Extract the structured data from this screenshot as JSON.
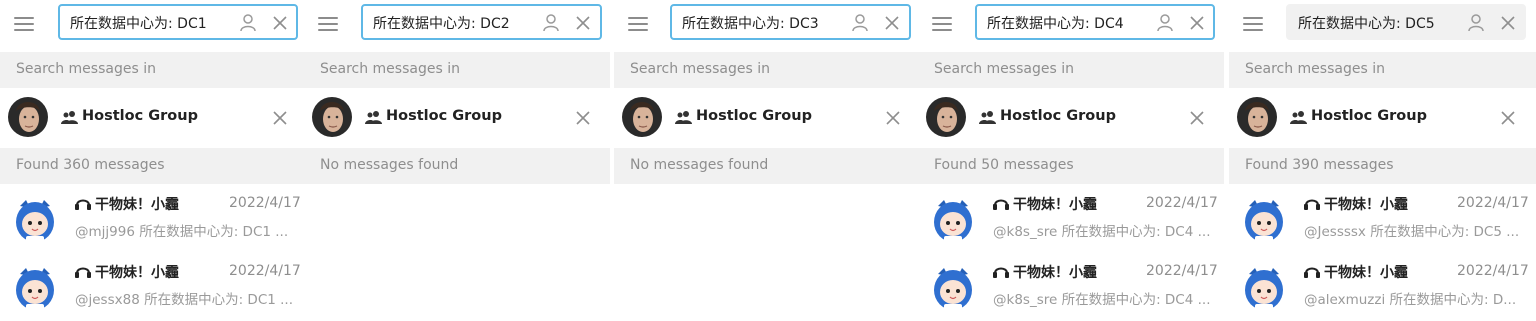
{
  "accent_color": "#5fb8e6",
  "panels": [
    {
      "search_value": "所在数据中心为: DC1",
      "search_label": "Search messages in",
      "chat_name": "Hostloc Group",
      "result_text": "Found 360 messages",
      "messages": [
        {
          "sender": "干物妹！小霾",
          "date": "2022/4/17",
          "snippet": "@mjj996 所在数据中心为: DC1 ..."
        },
        {
          "sender": "干物妹！小霾",
          "date": "2022/4/17",
          "snippet": "@jessx88 所在数据中心为: DC1 ..."
        }
      ]
    },
    {
      "search_value": "所在数据中心为: DC2",
      "search_label": "Search messages in",
      "chat_name": "Hostloc Group",
      "result_text": "No messages found",
      "messages": []
    },
    {
      "search_value": "所在数据中心为: DC3",
      "search_label": "Search messages in",
      "chat_name": "Hostloc Group",
      "result_text": "No messages found",
      "messages": []
    },
    {
      "search_value": "所在数据中心为: DC4",
      "search_label": "Search messages in",
      "chat_name": "Hostloc Group",
      "result_text": "Found 50 messages",
      "messages": [
        {
          "sender": "干物妹！小霾",
          "date": "2022/4/17",
          "snippet": "@k8s_sre 所在数据中心为: DC4 ..."
        },
        {
          "sender": "干物妹！小霾",
          "date": "2022/4/17",
          "snippet": "@k8s_sre 所在数据中心为: DC4 ..."
        }
      ]
    },
    {
      "search_value": "所在数据中心为: DC5",
      "search_label": "Search messages in",
      "chat_name": "Hostloc Group",
      "result_text": "Found 390 messages",
      "messages": [
        {
          "sender": "干物妹！小霾",
          "date": "2022/4/17",
          "snippet": "@Jessssx 所在数据中心为: DC5 ..."
        },
        {
          "sender": "干物妹！小霾",
          "date": "2022/4/17",
          "snippet": "@alexmuzzi 所在数据中心为: D..."
        }
      ]
    }
  ]
}
